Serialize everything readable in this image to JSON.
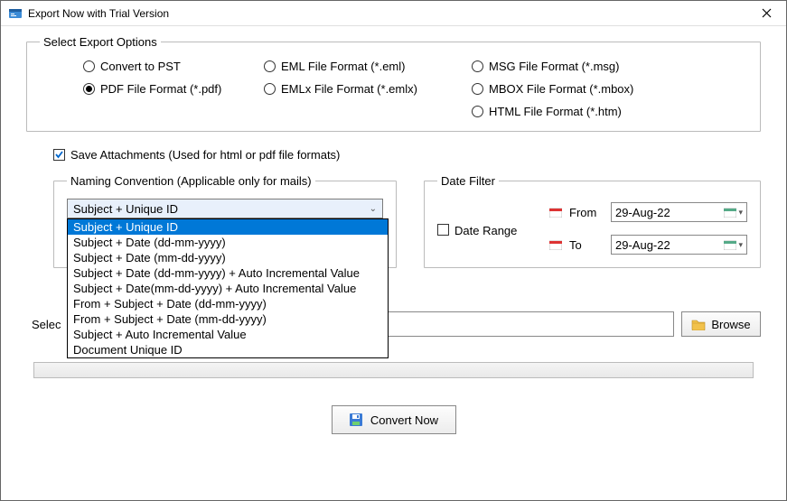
{
  "window": {
    "title": "Export Now with Trial Version"
  },
  "exportOptions": {
    "legend": "Select Export Options",
    "items": [
      {
        "label": "Convert to PST",
        "checked": false
      },
      {
        "label": "EML File  Format (*.eml)",
        "checked": false
      },
      {
        "label": "MSG File Format (*.msg)",
        "checked": false
      },
      {
        "label": "PDF File Format (*.pdf)",
        "checked": true
      },
      {
        "label": "EMLx File  Format (*.emlx)",
        "checked": false
      },
      {
        "label": "MBOX File Format (*.mbox)",
        "checked": false
      },
      {
        "label": "",
        "checked": false
      },
      {
        "label": "",
        "checked": false
      },
      {
        "label": "HTML File  Format (*.htm)",
        "checked": false
      }
    ]
  },
  "saveAttachments": {
    "label": "Save Attachments (Used for html or pdf file formats)",
    "checked": true
  },
  "naming": {
    "legend": "Naming Convention (Applicable only for mails)",
    "selected": "Subject + Unique ID",
    "options": [
      "Subject + Unique ID",
      "Subject + Date (dd-mm-yyyy)",
      "Subject + Date (mm-dd-yyyy)",
      "Subject + Date (dd-mm-yyyy) + Auto Incremental Value",
      "Subject + Date(mm-dd-yyyy) + Auto Incremental Value",
      "From + Subject + Date (dd-mm-yyyy)",
      "From + Subject + Date (mm-dd-yyyy)",
      "Subject + Auto Incremental Value",
      "Document Unique ID"
    ]
  },
  "dateFilter": {
    "legend": "Date Filter",
    "rangeLabel": "Date Range",
    "rangeChecked": false,
    "fromLabel": "From",
    "toLabel": "To",
    "fromValue": "29-Aug-22",
    "toValue": "29-Aug-22"
  },
  "destination": {
    "labelPartial": "Selec",
    "browseLabel": "Browse",
    "value": ""
  },
  "convert": {
    "label": "Convert Now"
  }
}
